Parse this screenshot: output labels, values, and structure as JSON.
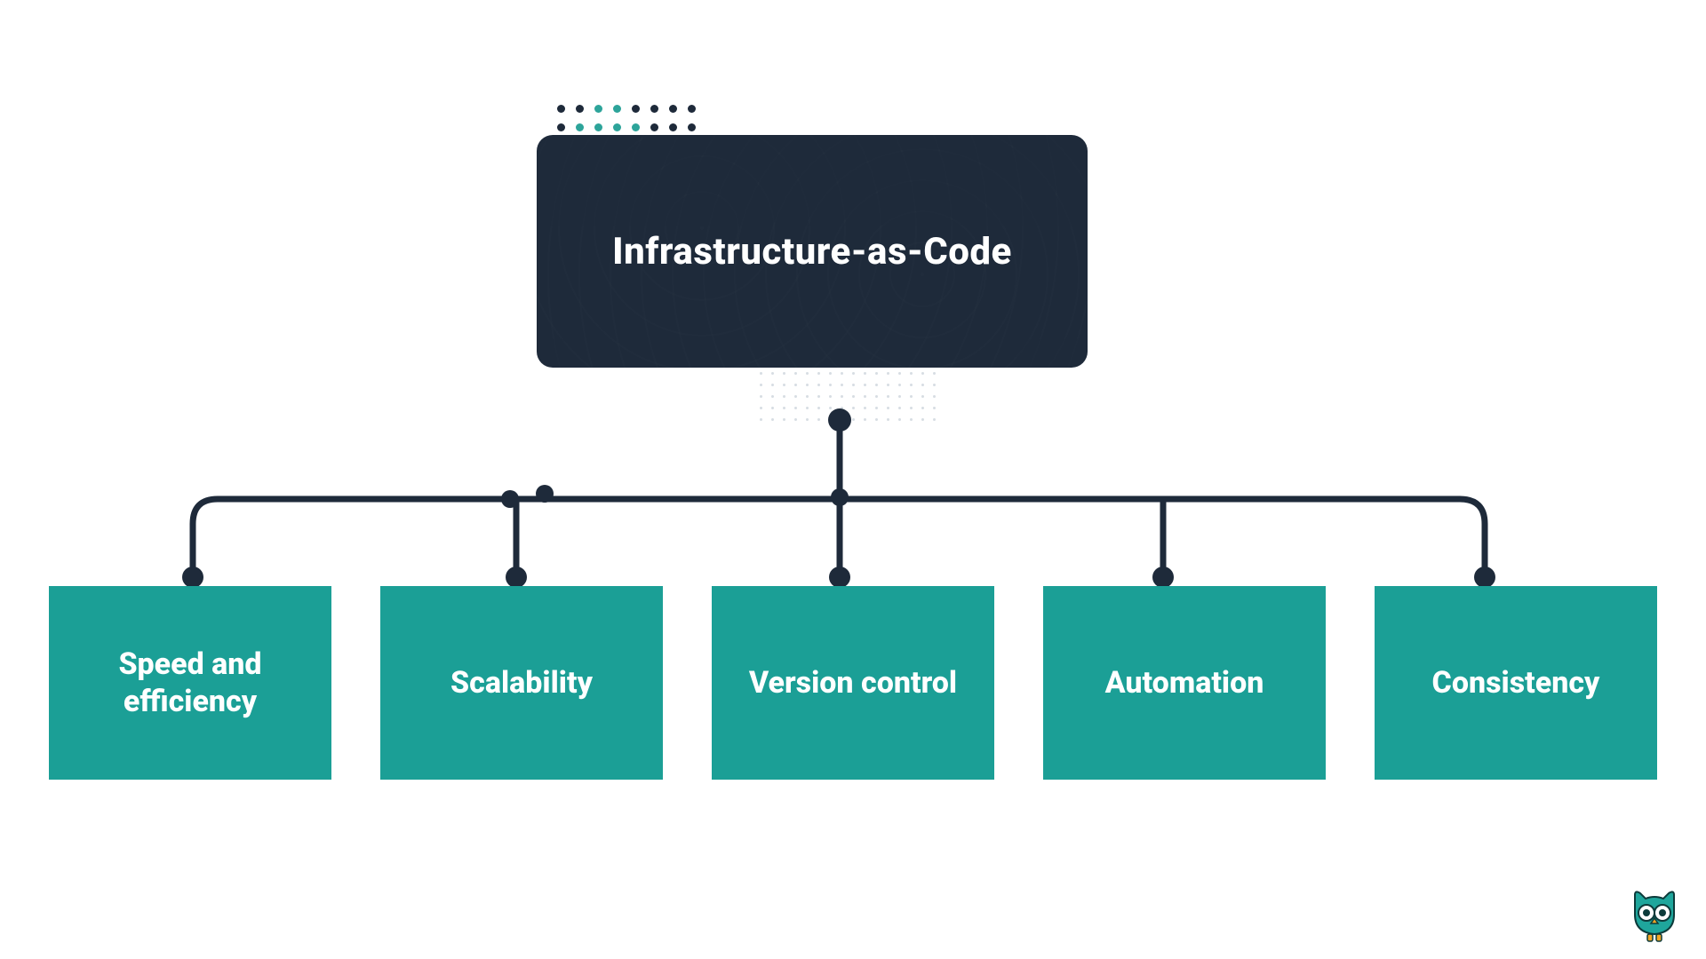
{
  "diagram": {
    "root": {
      "label": "Infrastructure-as-Code"
    },
    "children": [
      {
        "label": "Speed and efficiency"
      },
      {
        "label": "Scalability"
      },
      {
        "label": "Version control"
      },
      {
        "label": "Automation"
      },
      {
        "label": "Consistency"
      }
    ]
  },
  "colors": {
    "root_bg": "#1e2a3a",
    "child_bg": "#1b9f96",
    "text": "#ffffff",
    "connector": "#1e2a3a",
    "accent_teal": "#2da49a"
  }
}
